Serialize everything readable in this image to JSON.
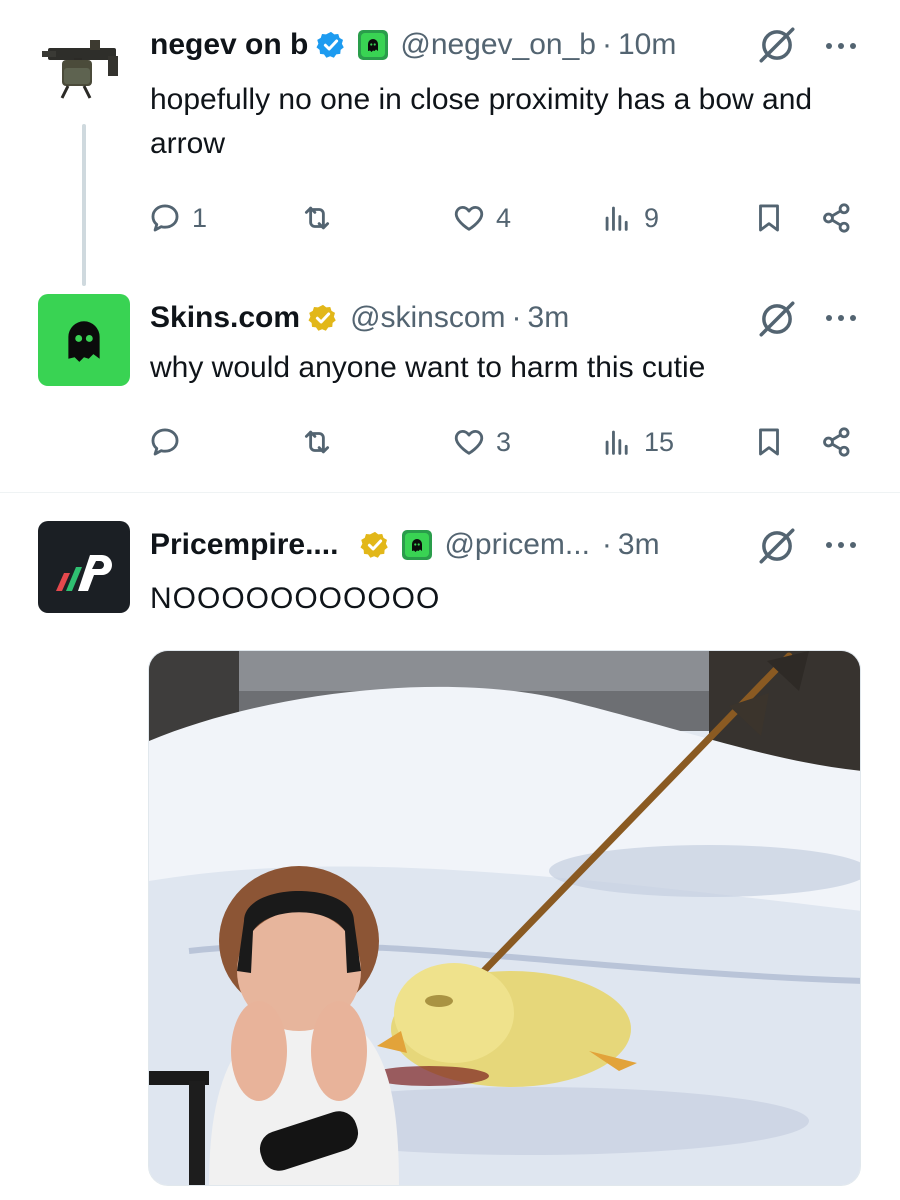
{
  "tweets": [
    {
      "name": "negev on b",
      "handle": "@negev_on_b",
      "separator": "·",
      "time": "10m",
      "text": "hopefully no one in close proximity has a bow and arrow",
      "verified": "blue",
      "affiliate": true,
      "counts": {
        "reply": "1",
        "retweet": "",
        "like": "4",
        "views": "9"
      }
    },
    {
      "name": "Skins.com",
      "handle": "@skinscom",
      "separator": "·",
      "time": "3m",
      "text": "why would anyone want to harm this cutie",
      "verified": "gold",
      "affiliate": false,
      "counts": {
        "reply": "",
        "retweet": "",
        "like": "3",
        "views": "15"
      }
    },
    {
      "name": "Pricempire....",
      "handle": "@pricem...",
      "separator": "·",
      "time": "3m",
      "text": "NOOOOOOOOOOO",
      "verified": "gold",
      "affiliate": true,
      "media": "image: streamer covering face beside a yellow chick with an arrow in the snow"
    }
  ],
  "icons": {
    "reply": "reply-icon",
    "retweet": "retweet-icon",
    "like": "heart-icon",
    "views": "views-icon",
    "bookmark": "bookmark-icon",
    "share": "share-icon",
    "grok": "grok-icon",
    "more": "more-icon"
  },
  "colors": {
    "text": "#0f1419",
    "muted": "#536471",
    "verified_blue": "#1d9bf0",
    "verified_gold": "#e2b719",
    "skins_green": "#39d353",
    "thread_line": "#cfd9de"
  }
}
